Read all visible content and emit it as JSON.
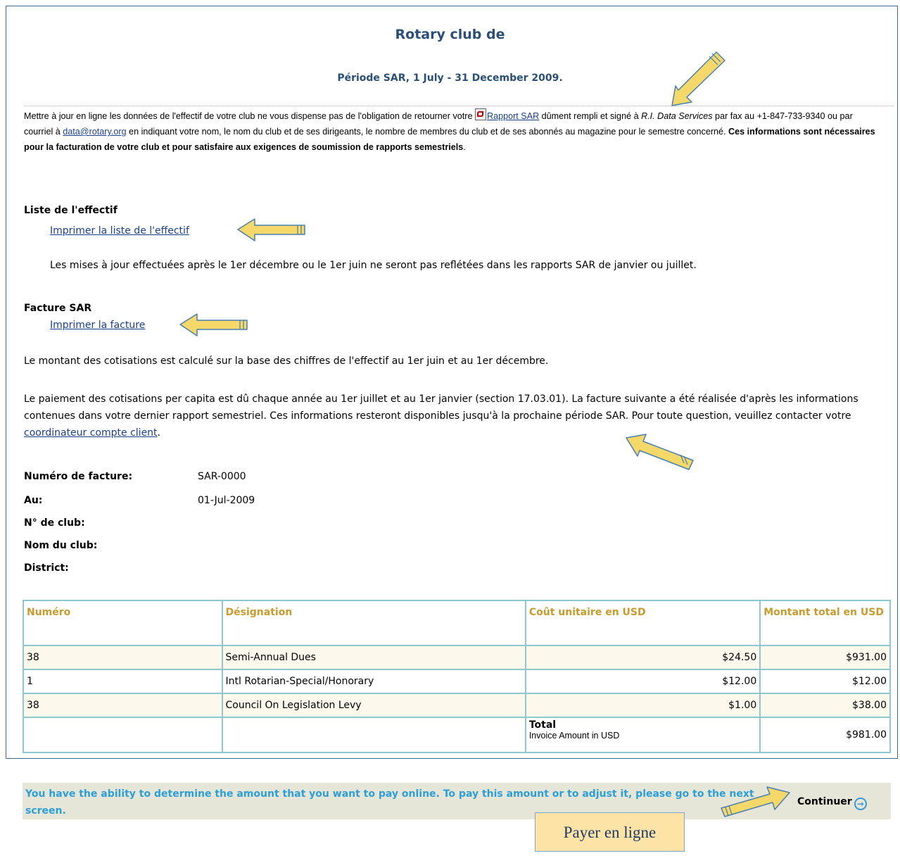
{
  "header": {
    "title": "Rotary club de",
    "period": "Période SAR, 1 July - 31 December 2009."
  },
  "intro": {
    "part1": "Mettre à jour en ligne les données de l'effectif de votre club ne vous dispense pas de l'obligation de retourner votre ",
    "report_link": "Rapport SAR",
    "part2": " dûment rempli et signé à ",
    "ri_data": "R.I. Data Services",
    "part3": " par fax au +1-847-733-9340 ou par courriel à ",
    "email_link": "data@rotary.org",
    "part4": " en indiquant votre nom, le nom du club et de ses dirigeants, le nombre de membres du club et de ses abonnés au magazine pour le semestre concerné. ",
    "bold": "Ces informations sont nécessaires pour la facturation de votre club et pour satisfaire aux exigences de soumission de rapports semestriels",
    "end": "."
  },
  "membership": {
    "heading": "Liste de l'effectif",
    "print_link": "Imprimer la liste de l'effectif",
    "note": "Les mises à jour effectuées après le 1er décembre ou le 1er juin ne seront pas reflétées dans les rapports SAR de janvier ou juillet."
  },
  "invoice_section": {
    "heading": "Facture SAR",
    "print_link": "Imprimer la facture",
    "calc_note": "Le montant des cotisations est calculé sur la base des chiffres de l'effectif au 1er juin et au 1er décembre.",
    "payment_note": "Le paiement des cotisations per capita est dû chaque année au 1er juillet et au 1er janvier (section 17.03.01). La facture suivante a été réalisée d'après les informations contenues dans votre dernier rapport semestriel. Ces informations resteront disponibles jusqu'à la prochaine période SAR. Pour toute question, veuillez contacter votre ",
    "contact_link": "coordinateur compte client",
    "payment_end": "."
  },
  "details": {
    "invoice_no_label": "Numéro de facture:",
    "invoice_no": "SAR-0000",
    "date_label": "Au:",
    "date": "01-Jul-2009",
    "club_no_label": "N° de club:",
    "club_name_label": "Nom du club:",
    "district_label": "District:"
  },
  "table": {
    "headers": [
      "Numéro",
      "Désignation",
      "Coût unitaire en USD",
      "Montant total en USD"
    ],
    "rows": [
      {
        "num": "38",
        "desc": "Semi-Annual Dues",
        "unit": "$24.50",
        "total": "$931.00"
      },
      {
        "num": "1",
        "desc": "Intl Rotarian-Special/Honorary",
        "unit": "$12.00",
        "total": "$12.00"
      },
      {
        "num": "38",
        "desc": "Council On Legislation Levy",
        "unit": "$1.00",
        "total": "$38.00"
      }
    ],
    "total_label": "Total",
    "total_sub": "Invoice Amount in USD",
    "total_value": "$981.00"
  },
  "footer": {
    "text": "You have the ability to determine the amount that you want to pay online. To pay this amount or to adjust it, please go to the next screen.",
    "continue": "Continuer",
    "continue_icon": "arrow-right-circle-icon"
  },
  "annotation": {
    "callout": "Payer en ligne",
    "arrow_color": "#f5d86a"
  }
}
